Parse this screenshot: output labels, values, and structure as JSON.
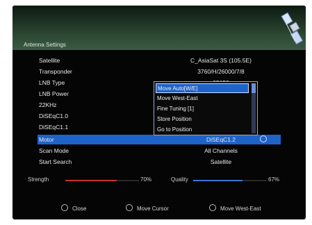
{
  "header": {
    "title": "Antenna Settings"
  },
  "settings": [
    {
      "label": "Satellite",
      "value": "C_AsiaSat 3S  (105.5E)"
    },
    {
      "label": "Transponder",
      "value": "3760/H/26000/7/8"
    },
    {
      "label": "LNB Type",
      "value": "05150"
    },
    {
      "label": "LNB Power",
      "value": ""
    },
    {
      "label": "22KHz",
      "value": ""
    },
    {
      "label": "DiSEqC1.0",
      "value": ""
    },
    {
      "label": "DiSEqC1.1",
      "value": ""
    },
    {
      "label": "Motor",
      "value": "DiSEqC1.2"
    },
    {
      "label": "Scan Mode",
      "value": "All Channels"
    },
    {
      "label": "Start Search",
      "value": "Satellite"
    }
  ],
  "popup": {
    "items": [
      "Move Auto[W/E]",
      "Move West-East",
      "Fine Tuning [1]",
      "Store Position",
      "Go to Position"
    ],
    "selected_index": 0
  },
  "meters": {
    "strength_label": "Strength",
    "strength_value": "70%",
    "strength_fraction": 0.7,
    "quality_label": "Quality",
    "quality_value": "67%",
    "quality_fraction": 0.67
  },
  "footer": {
    "close_label": "Close",
    "move_cursor_label": "Move Cursor",
    "move_west_east_label": "Move West-East"
  },
  "colors": {
    "highlight": "#1e63c8",
    "strength_bar": "#c73232",
    "quality_bar": "#3b77d8"
  },
  "icons": {
    "satellite": "satellite-icon",
    "info": "info-icon",
    "close": "ok-button-icon",
    "cursor": "cursor-button-icon",
    "west_east": "west-east-button-icon"
  }
}
